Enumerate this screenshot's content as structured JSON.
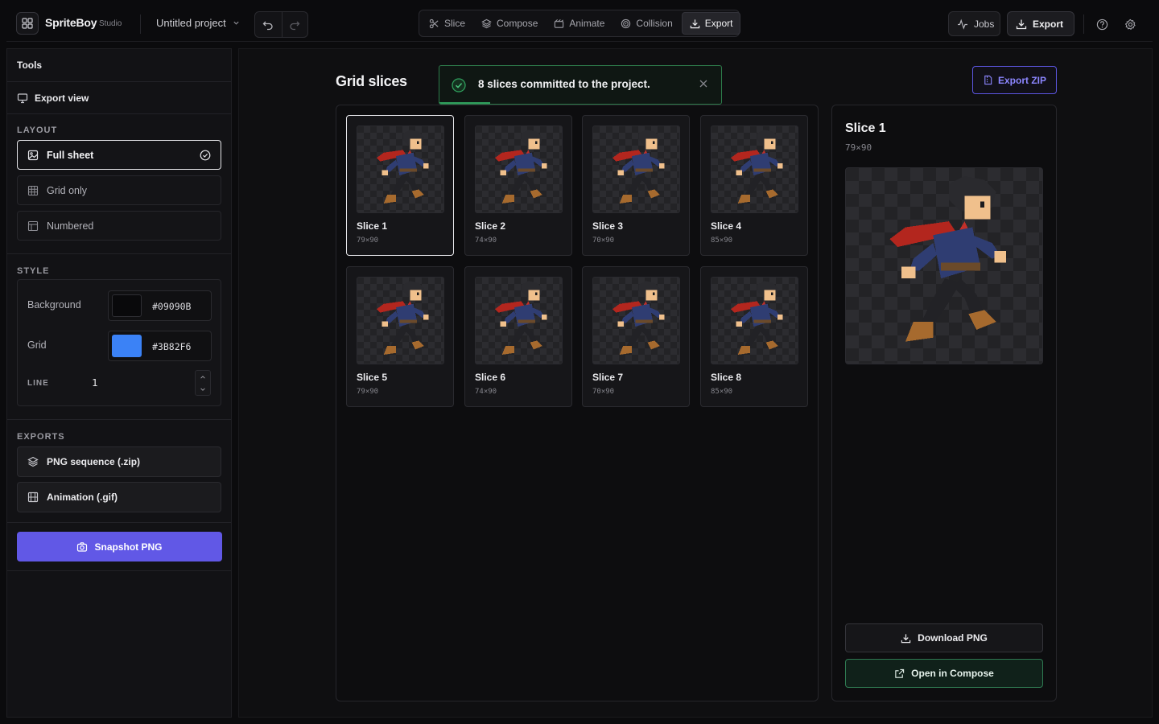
{
  "app": {
    "name": "SpriteBoy",
    "suffix": "Studio",
    "project": "Untitled project"
  },
  "modes": [
    {
      "label": "Slice",
      "icon": "scissors-icon",
      "active": false
    },
    {
      "label": "Compose",
      "icon": "layers-icon",
      "active": false
    },
    {
      "label": "Animate",
      "icon": "film-icon",
      "active": false
    },
    {
      "label": "Collision",
      "icon": "target-icon",
      "active": false
    },
    {
      "label": "Export",
      "icon": "download-icon",
      "active": true
    }
  ],
  "topbar": {
    "jobs_label": "Jobs",
    "export_label": "Export"
  },
  "sidebar": {
    "title": "Tools",
    "view_label": "Export view",
    "layout_label": "LAYOUT",
    "layout_options": [
      {
        "label": "Full sheet",
        "icon": "image-icon",
        "selected": true
      },
      {
        "label": "Grid only",
        "icon": "grid-icon",
        "selected": false
      },
      {
        "label": "Numbered",
        "icon": "table-icon",
        "selected": false
      }
    ],
    "style_label": "STYLE",
    "background_label": "Background",
    "background_hex": "#09090B",
    "grid_label": "Grid",
    "grid_hex": "#3B82F6",
    "line_label": "LINE",
    "line_value": "1",
    "exports_label": "EXPORTS",
    "exports": [
      {
        "label": "PNG sequence (.zip)",
        "icon": "layers-icon"
      },
      {
        "label": "Animation (.gif)",
        "icon": "film-icon"
      }
    ],
    "snapshot_label": "Snapshot PNG"
  },
  "main": {
    "title": "Grid slices",
    "toast": {
      "message": "8 slices committed to the project.",
      "progress": 0.18
    },
    "export_zip_label": "Export ZIP",
    "slices": [
      {
        "name": "Slice 1",
        "dims": "79×90",
        "selected": true
      },
      {
        "name": "Slice 2",
        "dims": "74×90",
        "selected": false
      },
      {
        "name": "Slice 3",
        "dims": "70×90",
        "selected": false
      },
      {
        "name": "Slice 4",
        "dims": "85×90",
        "selected": false
      },
      {
        "name": "Slice 5",
        "dims": "79×90",
        "selected": false
      },
      {
        "name": "Slice 6",
        "dims": "74×90",
        "selected": false
      },
      {
        "name": "Slice 7",
        "dims": "70×90",
        "selected": false
      },
      {
        "name": "Slice 8",
        "dims": "85×90",
        "selected": false
      }
    ],
    "detail": {
      "name": "Slice 1",
      "dims": "79×90",
      "download_label": "Download PNG",
      "open_label": "Open in Compose"
    }
  },
  "colors": {
    "accent": "#6158E6",
    "success": "#2F9E5C",
    "grid": "#3B82F6",
    "background": "#09090B"
  }
}
